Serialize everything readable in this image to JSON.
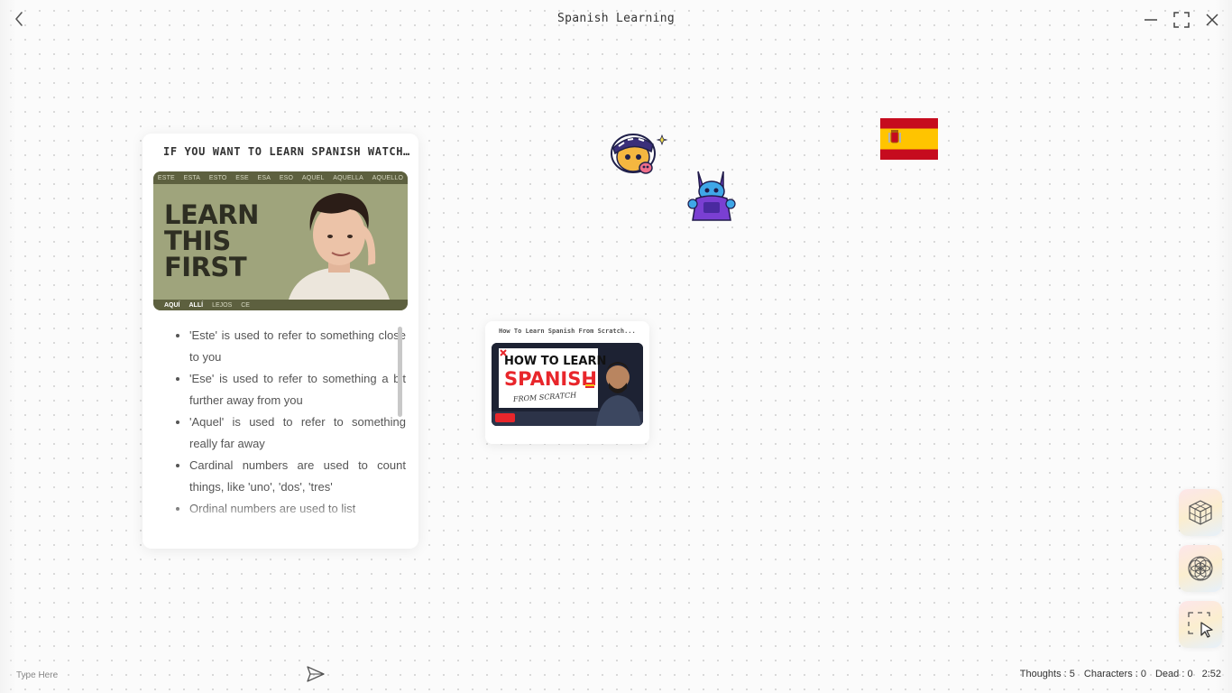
{
  "window": {
    "title": "Spanish Learning"
  },
  "note_card": {
    "title": "IF YOU WANT TO LEARN SPANISH WATCH...",
    "thumbnail": {
      "top_strip_words": [
        "ESTE",
        "ESTA",
        "ESTO",
        "ESE",
        "ESA",
        "ESO",
        "AQUEL",
        "AQUELLA",
        "AQUELLO"
      ],
      "headline_lines": [
        "LEARN",
        "THIS",
        "FIRST"
      ],
      "bottom_strip_words": [
        "AQUÍ",
        "ALLÍ",
        "LEJOS",
        "CE"
      ],
      "colors": {
        "background": "#9fa47c",
        "strip": "#5d603f"
      }
    },
    "bullets": [
      "'Este' is used to refer to something close to you",
      "'Ese' is used to refer to something a bit further away from you",
      "'Aquel' is used to refer to something really far away",
      "Cardinal numbers are used to count things, like 'uno', 'dos', 'tres'",
      "Ordinal numbers are used to list"
    ]
  },
  "video_card": {
    "title": "How To Learn Spanish From Scratch...",
    "thumbnail": {
      "line1": "HOW TO LEARN",
      "line2": "SPANISH",
      "line3": "FROM SCRATCH",
      "colors": {
        "accent": "#e8262b",
        "background": "#1d2233"
      }
    }
  },
  "stickers": {
    "flag": "spain-flag",
    "character1": "mariachi-skull-sticker",
    "character2": "purple-knight-sticker"
  },
  "tools": {
    "items": [
      "cube-grid-icon",
      "flower-of-life-icon",
      "select-cursor-icon"
    ]
  },
  "chat": {
    "placeholder": "Type Here"
  },
  "stats": {
    "thoughts": "Thoughts : 5",
    "characters": "Characters : 0",
    "dead": "Dead : 0",
    "time": "2:52"
  }
}
